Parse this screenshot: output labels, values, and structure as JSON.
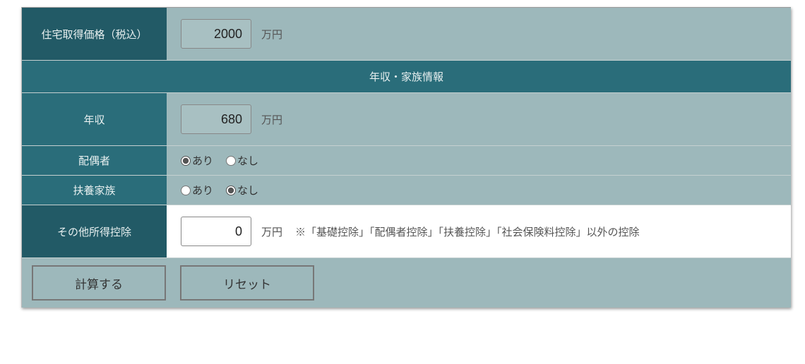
{
  "fields": {
    "housing_price": {
      "label": "住宅取得価格（税込）",
      "value": "2000",
      "unit": "万円"
    },
    "section_header": "年収・家族情報",
    "annual_income": {
      "label": "年収",
      "value": "680",
      "unit": "万円"
    },
    "spouse": {
      "label": "配偶者",
      "option_yes": "あり",
      "option_no": "なし"
    },
    "dependents": {
      "label": "扶養家族",
      "option_yes": "あり",
      "option_no": "なし"
    },
    "other_deduction": {
      "label": "その他所得控除",
      "value": "0",
      "unit": "万円",
      "note": "※「基礎控除」「配偶者控除」「扶養控除」「社会保険料控除」以外の控除"
    }
  },
  "buttons": {
    "calculate": "計算する",
    "reset": "リセット"
  }
}
